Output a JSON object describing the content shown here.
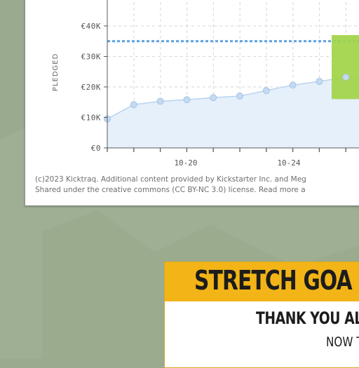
{
  "chart_data": {
    "type": "line",
    "ylabel": "PLEDGED",
    "y_ticks": [
      "€0",
      "€10K",
      "€20K",
      "€30K",
      "€40K"
    ],
    "ylim": [
      0,
      50000
    ],
    "x_tick_labels": [
      "10-20",
      "10-24"
    ],
    "series": [
      {
        "values": [
          9500,
          14200,
          15300,
          15800,
          16500,
          17000,
          18800,
          20600,
          21800,
          23200
        ]
      }
    ],
    "goal_line": 35000,
    "highlight_region": {
      "y_from": 16000,
      "y_to": 37000
    },
    "grid": true,
    "colors": {
      "line": "#b9d3ee",
      "fill": "#e6f0fb",
      "goal": "#5aa0e0",
      "highlight": "#9fd447"
    }
  },
  "credits": {
    "line1": "(c)2023 Kicktraq. Additional content provided by Kickstarter Inc. and Meg",
    "line2": "Shared under the creative commons (CC BY-NC 3.0) license. Read more a"
  },
  "banner": {
    "title": "STRETCH GOA",
    "line1": "THANK YOU ALL",
    "line2": "NOW T",
    "colors": {
      "header": "#f2b416",
      "text": "#1c1c1c"
    }
  }
}
